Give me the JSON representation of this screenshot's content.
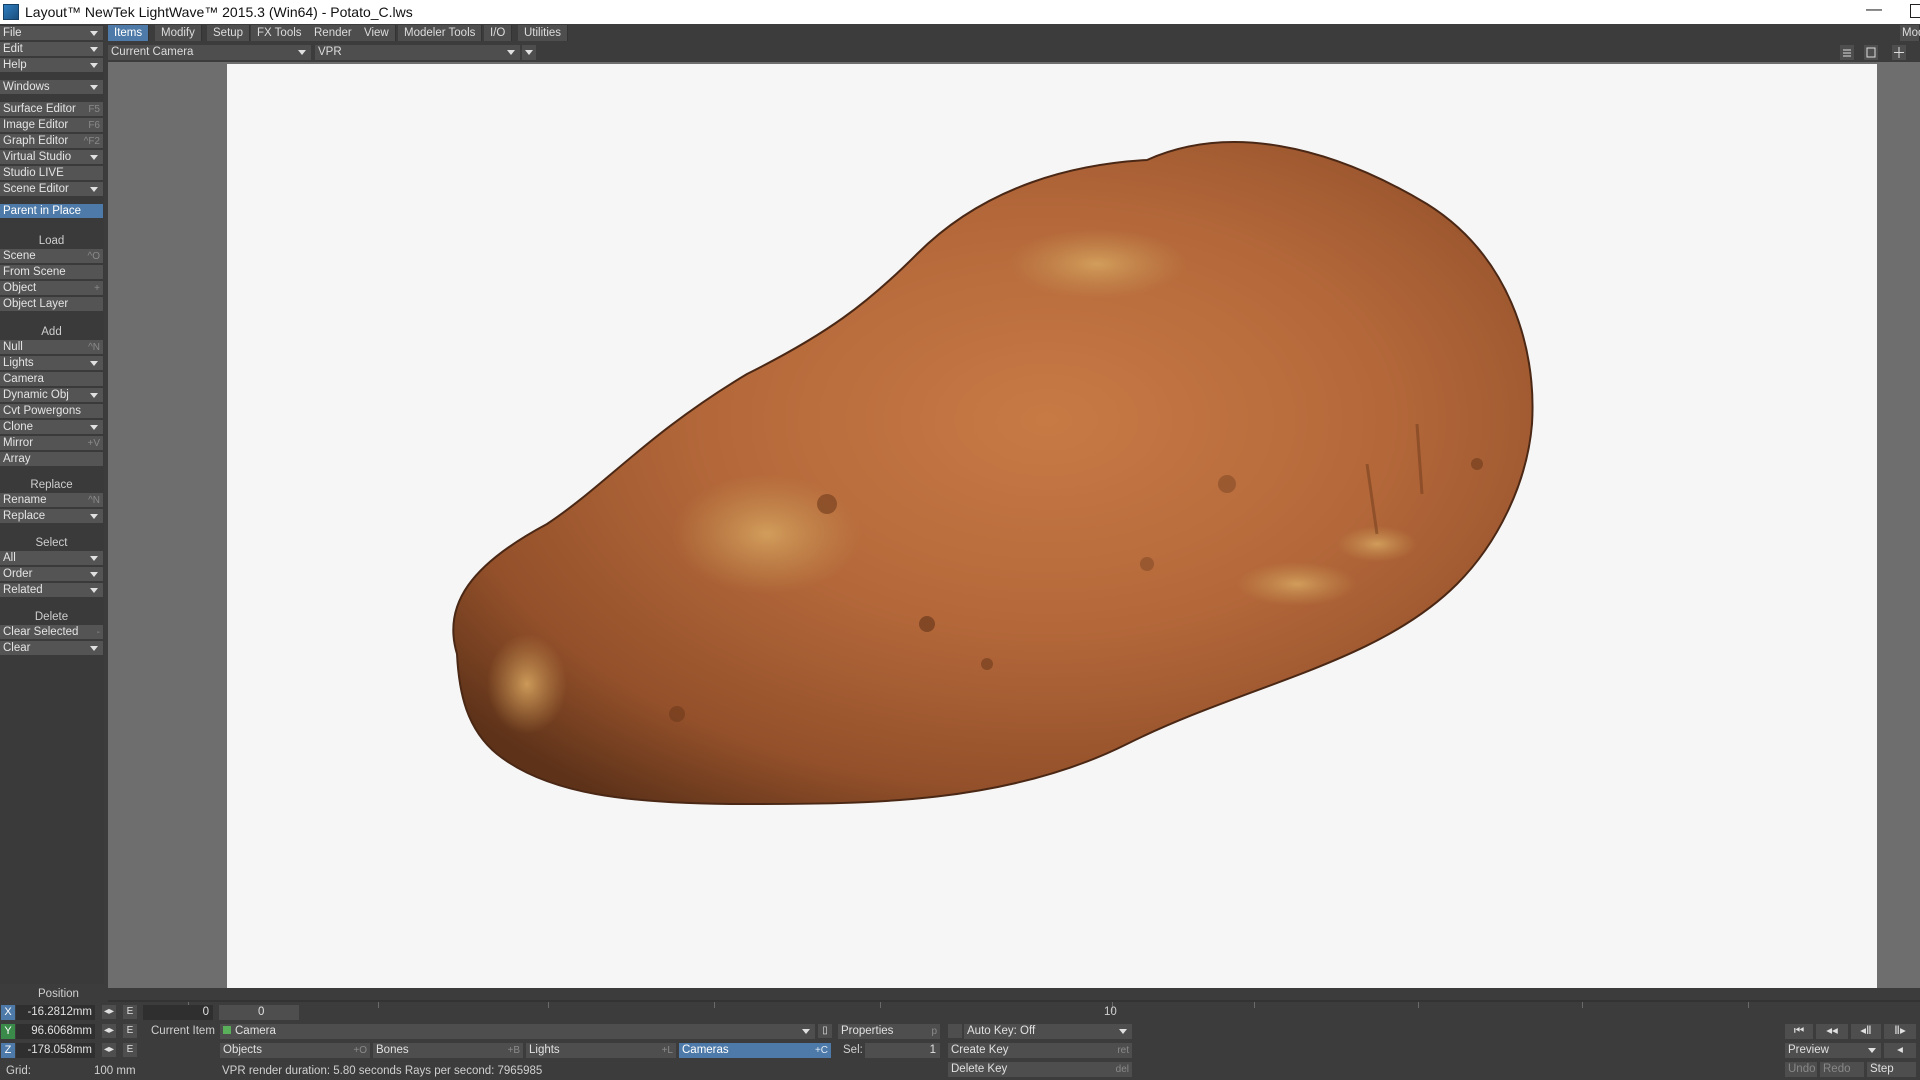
{
  "window": {
    "title": "Layout™ NewTek LightWave™ 2015.3 (Win64) - Potato_C.lws",
    "minimize": "—"
  },
  "left_panel": {
    "menus": [
      {
        "label": "File"
      },
      {
        "label": "Edit"
      },
      {
        "label": "Help"
      },
      {
        "label": "Windows"
      }
    ],
    "editors": [
      {
        "label": "Surface Editor",
        "shortcut": "F5"
      },
      {
        "label": "Image Editor",
        "shortcut": "F6"
      },
      {
        "label": "Graph Editor",
        "shortcut": "^F2"
      },
      {
        "label": "Virtual Studio",
        "shortcut": ""
      },
      {
        "label": "Studio LIVE",
        "shortcut": ""
      },
      {
        "label": "Scene Editor",
        "shortcut": ""
      }
    ],
    "parent_in_place": "Parent in Place",
    "load_header": "Load",
    "load": [
      {
        "label": "Scene",
        "shortcut": "^O"
      },
      {
        "label": "From Scene",
        "shortcut": ""
      },
      {
        "label": "Object",
        "shortcut": "+"
      },
      {
        "label": "Object Layer",
        "shortcut": ""
      }
    ],
    "add_header": "Add",
    "add": [
      {
        "label": "Null",
        "shortcut": "^N"
      },
      {
        "label": "Lights",
        "shortcut": ""
      },
      {
        "label": "Camera",
        "shortcut": ""
      },
      {
        "label": "Dynamic Obj",
        "shortcut": ""
      },
      {
        "label": "Cvt Powergons",
        "shortcut": ""
      },
      {
        "label": "Clone",
        "shortcut": ""
      },
      {
        "label": "Mirror",
        "shortcut": "+V"
      },
      {
        "label": "Array",
        "shortcut": ""
      }
    ],
    "replace_header": "Replace",
    "replace": [
      {
        "label": "Rename",
        "shortcut": "^N"
      },
      {
        "label": "Replace",
        "shortcut": ""
      }
    ],
    "select_header": "Select",
    "select": [
      {
        "label": "All"
      },
      {
        "label": "Order"
      },
      {
        "label": "Related"
      }
    ],
    "delete_header": "Delete",
    "delete": [
      {
        "label": "Clear Selected",
        "shortcut": "-"
      },
      {
        "label": "Clear",
        "shortcut": ""
      }
    ]
  },
  "tabs": [
    "Items",
    "Modify",
    "Setup",
    "FX Tools",
    "Render",
    "View",
    "Modeler Tools",
    "I/O",
    "Utilities"
  ],
  "modeler_btn": "Mod",
  "viewport": {
    "camera_select": "Current Camera",
    "render_mode": "VPR"
  },
  "position": {
    "header": "Position",
    "x": {
      "axis": "X",
      "value": "-16.2812mm"
    },
    "y": {
      "axis": "Y",
      "value": "96.6068mm"
    },
    "z": {
      "axis": "Z",
      "value": "-178.058mm"
    },
    "grid_label": "Grid:",
    "grid_value": "100 mm"
  },
  "timeline": {
    "frame_value": "0",
    "slider_value": "0",
    "tick_10": "10"
  },
  "bottom": {
    "e_label": "E",
    "current_item_label": "Current Item",
    "current_item": "Camera",
    "properties": "Properties",
    "properties_sc": "p",
    "auto_key": "Auto Key: Off",
    "objects": "Objects",
    "objects_sc": "+O",
    "bones": "Bones",
    "bones_sc": "+B",
    "lights": "Lights",
    "lights_sc": "+L",
    "cameras": "Cameras",
    "cameras_sc": "+C",
    "sel_label": "Sel:",
    "sel_value": "1",
    "create_key": "Create Key",
    "create_key_sc": "ret",
    "delete_key": "Delete Key",
    "delete_key_sc": "del",
    "status": "VPR render duration: 5.80 seconds  Rays per second: 7965985",
    "preview": "Preview",
    "undo": "Undo",
    "redo": "Redo",
    "step": "Step"
  },
  "colors": {
    "accent": "#4d7aa8",
    "panel": "#3c3c3c",
    "button": "#545454",
    "viewport_bg": "#f6f6f6"
  }
}
